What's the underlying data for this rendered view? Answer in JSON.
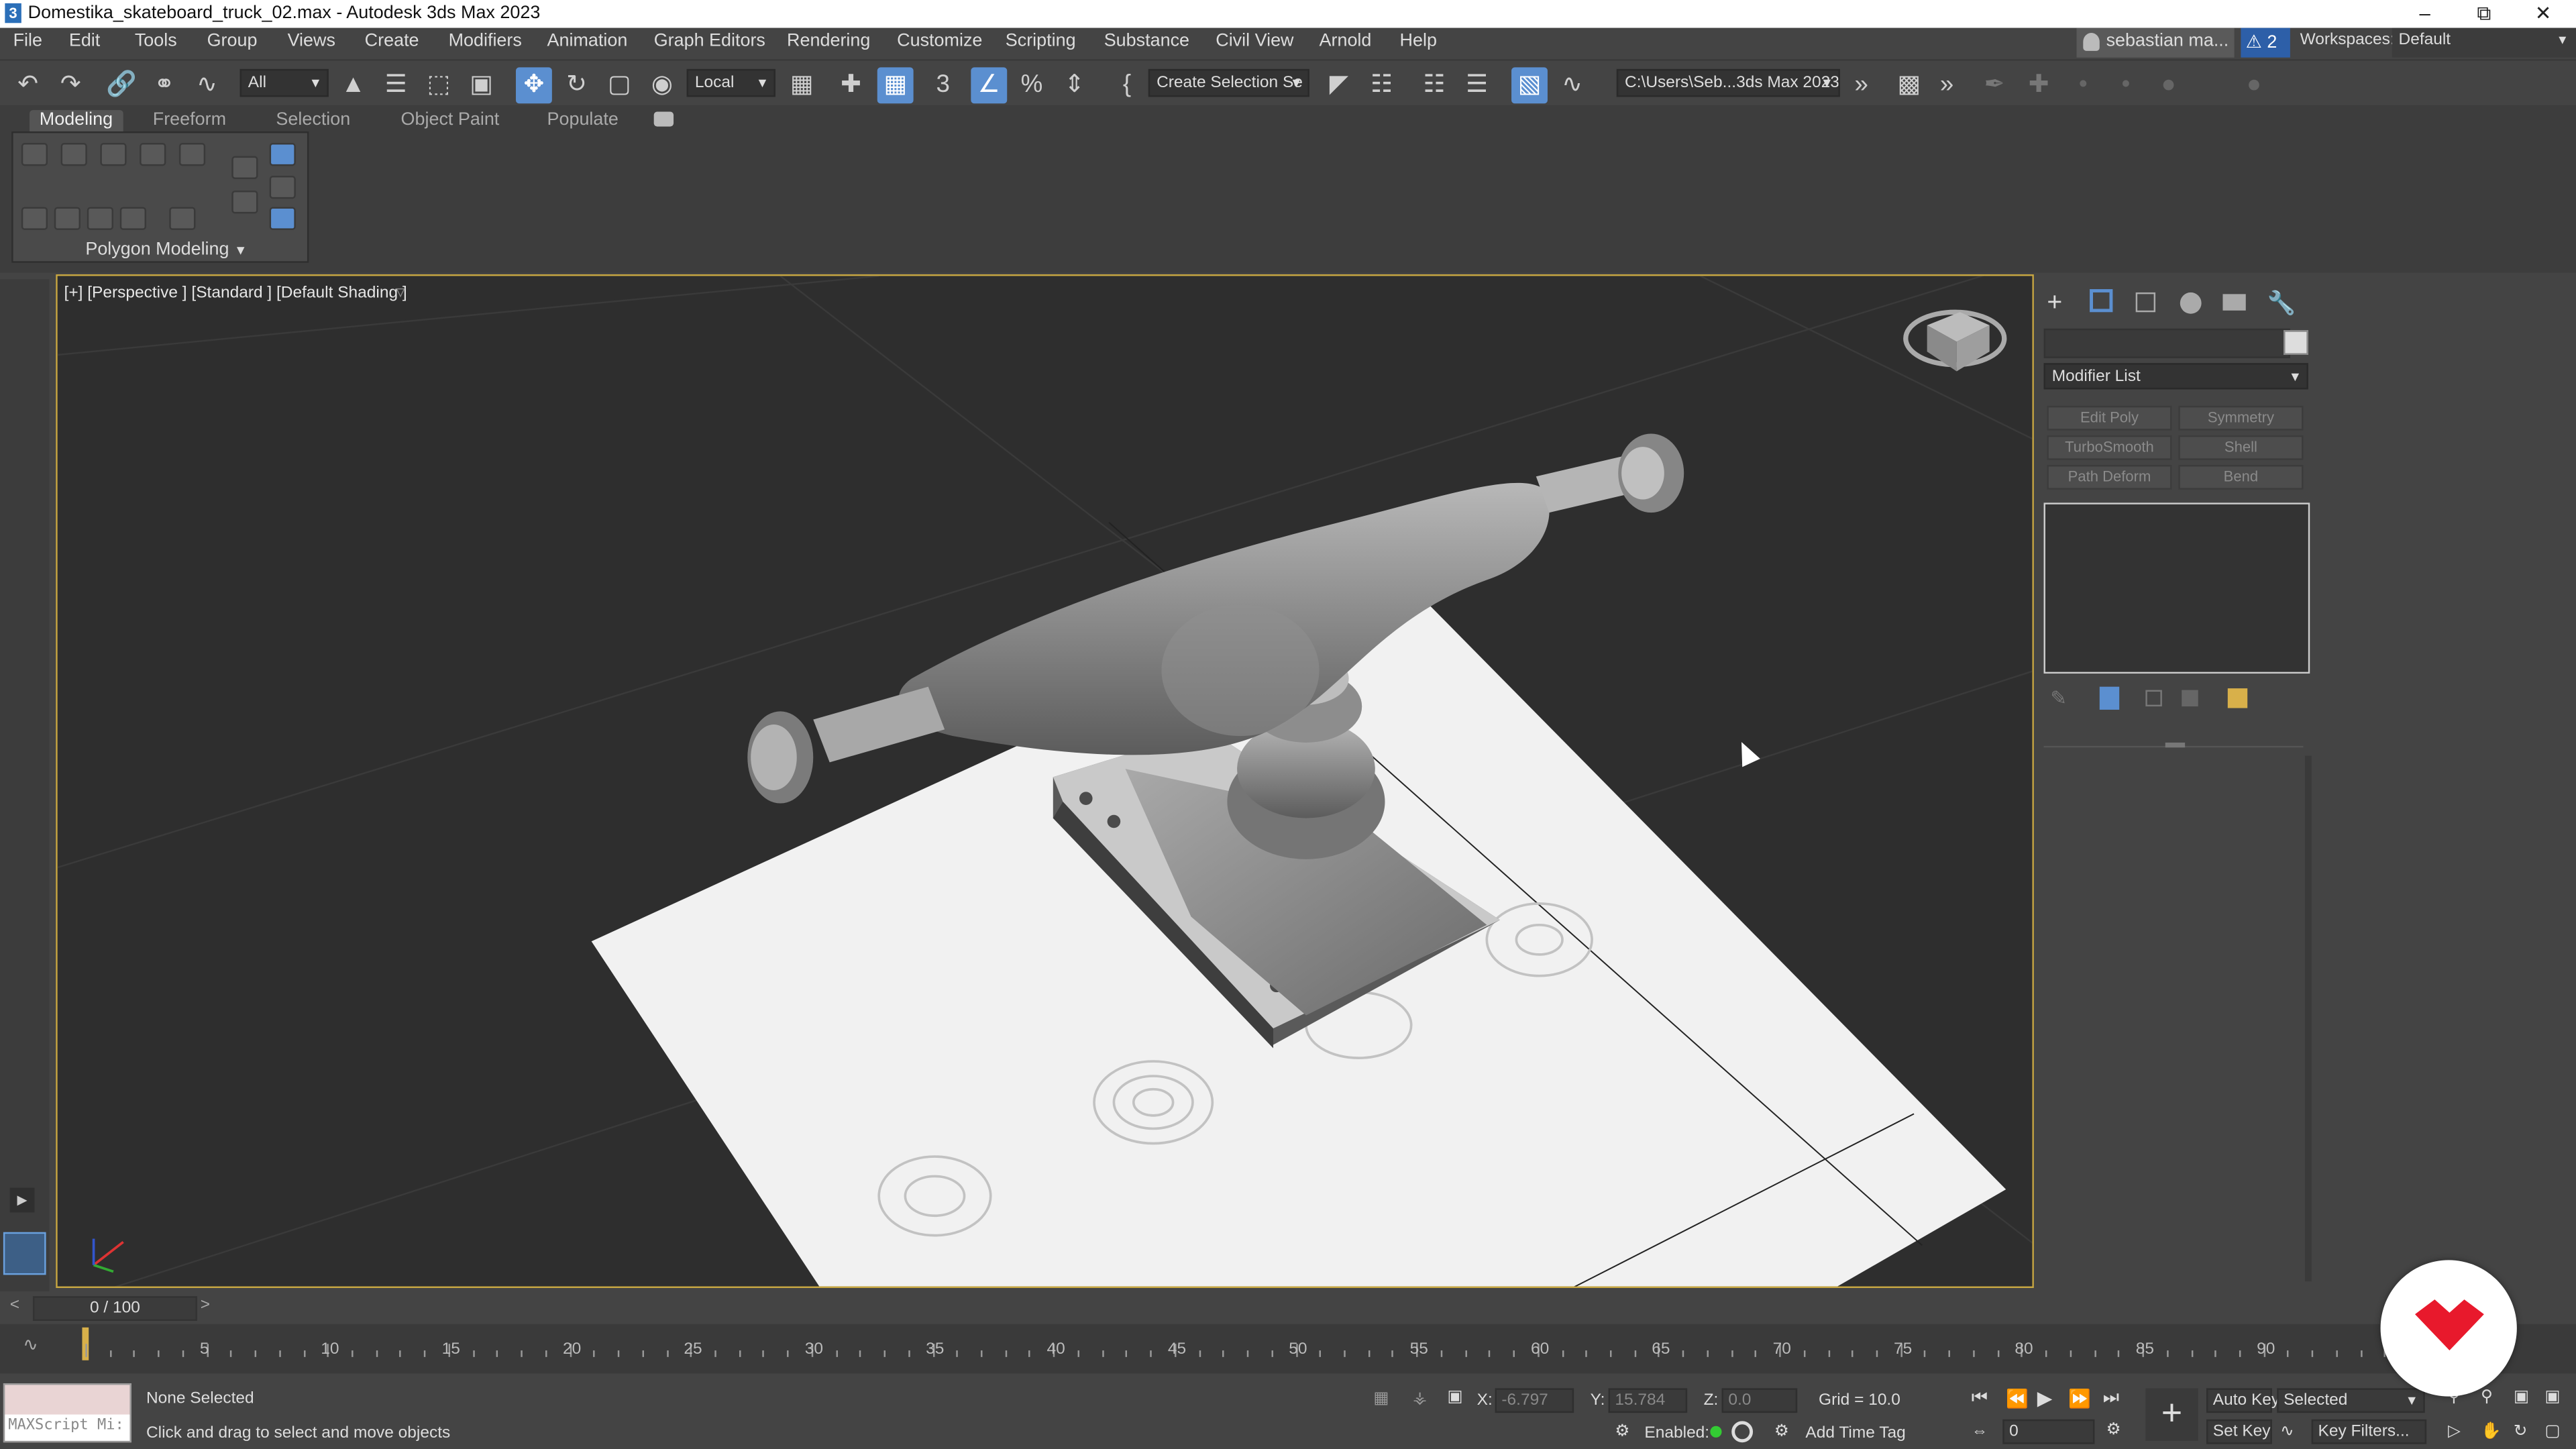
{
  "window": {
    "title": "Domestika_skateboard_truck_02.max - Autodesk 3ds Max 2023",
    "app_icon_letter": "3"
  },
  "menu": [
    "File",
    "Edit",
    "Tools",
    "Group",
    "Views",
    "Create",
    "Modifiers",
    "Animation",
    "Graph Editors",
    "Rendering",
    "Customize",
    "Scripting",
    "Substance",
    "Civil View",
    "Arnold",
    "Help"
  ],
  "account": {
    "user": "sebastian ma...",
    "alerts": "2",
    "workspaces_label": "Workspaces:",
    "workspace": "Default"
  },
  "toolbar": {
    "selection_filter": "All",
    "coord_system": "Local",
    "snap_angle": "3",
    "create_selection_set": "Create Selection Se",
    "project_path": "C:\\Users\\Seb...3ds Max 2023"
  },
  "ribbon": {
    "tabs": [
      "Modeling",
      "Freeform",
      "Selection",
      "Object Paint",
      "Populate"
    ],
    "active_tab": "Modeling",
    "panel_label": "Polygon Modeling"
  },
  "viewport": {
    "label": "[+] [Perspective ] [Standard ] [Default Shading ]"
  },
  "command_panel": {
    "modifier_list": "Modifier List",
    "modifier_buttons": [
      "Edit Poly",
      "Symmetry",
      "TurboSmooth",
      "Shell",
      "Path Deform",
      "Bend"
    ]
  },
  "timeline": {
    "slider": "0 / 100",
    "labels": [
      "5",
      "10",
      "15",
      "20",
      "25",
      "30",
      "35",
      "40",
      "45",
      "50",
      "55",
      "60",
      "65",
      "70",
      "75",
      "80",
      "85",
      "90"
    ]
  },
  "status": {
    "maxscript": "MAXScript Mi:",
    "selection": "None Selected",
    "prompt": "Click and drag to select and move objects",
    "x_label": "X:",
    "x_value": "-6.797",
    "y_label": "Y:",
    "y_value": "15.784",
    "z_label": "Z:",
    "z_value": "0.0",
    "grid": "Grid = 10.0",
    "enabled_label": "Enabled:",
    "add_time_tag": "Add Time Tag",
    "frame": "0",
    "auto_key": "Auto Key",
    "set_key": "Set Key",
    "key_mode": "Selected",
    "key_filters": "Key Filters..."
  },
  "colors": {
    "accent_blue": "#5b8fd0",
    "viewport_border": "#c8a742",
    "domestika_red": "#e8192c"
  }
}
